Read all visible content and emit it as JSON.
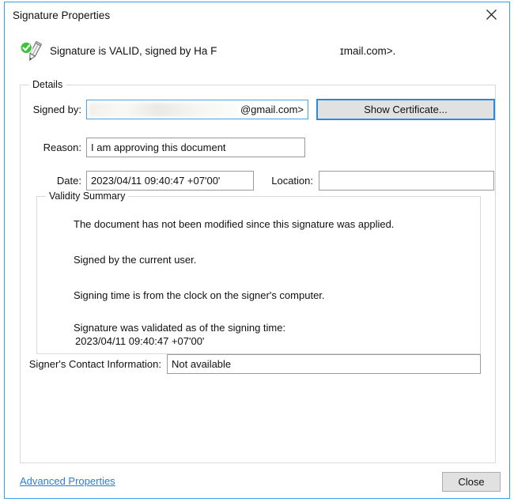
{
  "window": {
    "title": "Signature Properties",
    "close_icon": "close-icon",
    "frame_color": "#3aa0e8"
  },
  "status": {
    "icon": "signature-valid-icon",
    "text_before": "Signature is VALID, signed by Ha F",
    "text_after": "ɪmail.com>.",
    "valid_color": "#3fc23f"
  },
  "details": {
    "legend": "Details",
    "signed_by": {
      "label": "Signed by:",
      "value": "@gmail.com>",
      "redacted": true
    },
    "show_certificate": {
      "label": "Show Certificate..."
    },
    "reason": {
      "label": "Reason:",
      "value": "I am approving this document",
      "placeholder": ""
    },
    "date": {
      "label": "Date:",
      "value": "2023/04/11 09:40:47 +07'00'",
      "placeholder": ""
    },
    "location": {
      "label": "Location:",
      "value": "",
      "placeholder": ""
    },
    "validity": {
      "legend": "Validity Summary",
      "lines": [
        "The document has not been modified since this signature was applied.",
        "Signed by the current user.",
        "Signing time is from the clock on the signer's computer.",
        "Signature was validated as of the signing time:"
      ],
      "validated_time": "2023/04/11 09:40:47 +07'00'"
    },
    "contact": {
      "label": "Signer's Contact Information:",
      "value": "Not available",
      "placeholder": ""
    }
  },
  "footer": {
    "advanced_properties": "Advanced Properties",
    "close": "Close",
    "link_color": "#2a7fd4"
  }
}
